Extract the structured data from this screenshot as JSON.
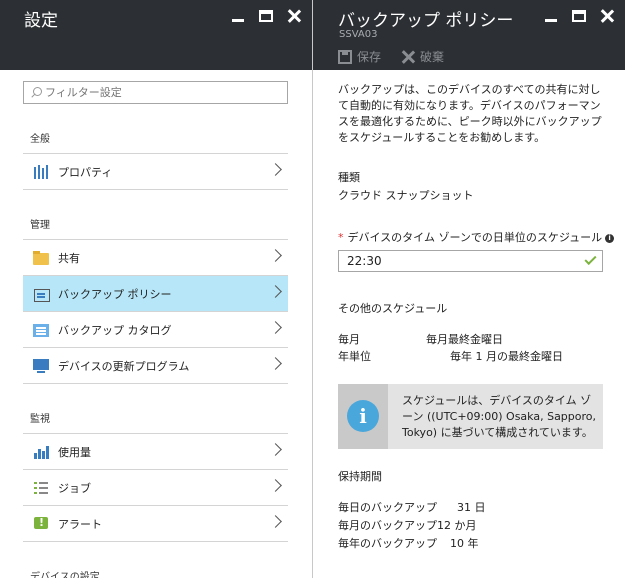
{
  "left": {
    "title": "設定",
    "filter_placeholder": "フィルター設定",
    "sections": {
      "general": "全般",
      "manage": "管理",
      "monitor": "監視",
      "device_settings": "デバイスの設定"
    },
    "items": {
      "properties": "プロパティ",
      "shares": "共有",
      "backup_policy": "バックアップ ポリシー",
      "backup_catalog": "バックアップ カタログ",
      "device_updates": "デバイスの更新プログラム",
      "usage": "使用量",
      "jobs": "ジョブ",
      "alerts": "アラート"
    }
  },
  "right": {
    "title": "バックアップ ポリシー",
    "subtitle": "SSVA03",
    "save_label": "保存",
    "discard_label": "破棄",
    "intro": "バックアップは、このデバイスのすべての共有に対して自動的に有効になります。デバイスのパフォーマンスを最適化するために、ピーク時以外にバックアップをスケジュールすることをお勧めします。",
    "type_label": "種類",
    "type_value": "クラウド スナップショット",
    "daily_label": "デバイスのタイム ゾーンでの日単位のスケジュール",
    "daily_value": "22:30",
    "other_label": "その他のスケジュール",
    "monthly_key": "毎月",
    "monthly_value": "毎月最終金曜日",
    "yearly_key": "年単位",
    "yearly_value": "毎年 1 月の最終金曜日",
    "info_text": "スケジュールは、デバイスのタイム ゾーン ((UTC+09:00) Osaka, Sapporo, Tokyo) に基づいて構成されています。",
    "retention_label": "保持期間",
    "retention": [
      {
        "key": "毎日のバックアップ",
        "value": "31 日"
      },
      {
        "key": "毎月のバックアップ",
        "value": "12 か月"
      },
      {
        "key": "毎年のバックアップ",
        "value": "10 年"
      }
    ]
  }
}
